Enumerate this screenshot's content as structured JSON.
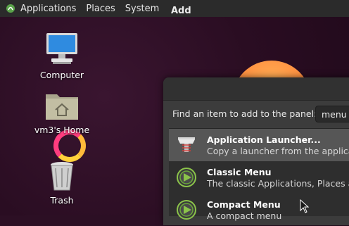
{
  "top_panel": {
    "applications_label": "Applications",
    "places_label": "Places",
    "system_label": "System"
  },
  "desktop": {
    "icons": [
      {
        "label": "Computer"
      },
      {
        "label": "vm3's Home"
      },
      {
        "label": "Trash"
      }
    ]
  },
  "dialog": {
    "title": "Add",
    "find_label": "Find an item to add to the panel:",
    "search_value": "menu",
    "items": [
      {
        "name": "Application Launcher...",
        "description": "Copy a launcher from the applicat"
      },
      {
        "name": "Classic Menu",
        "description": "The classic Applications, Places an"
      },
      {
        "name": "Compact Menu",
        "description": "A compact menu"
      }
    ]
  }
}
